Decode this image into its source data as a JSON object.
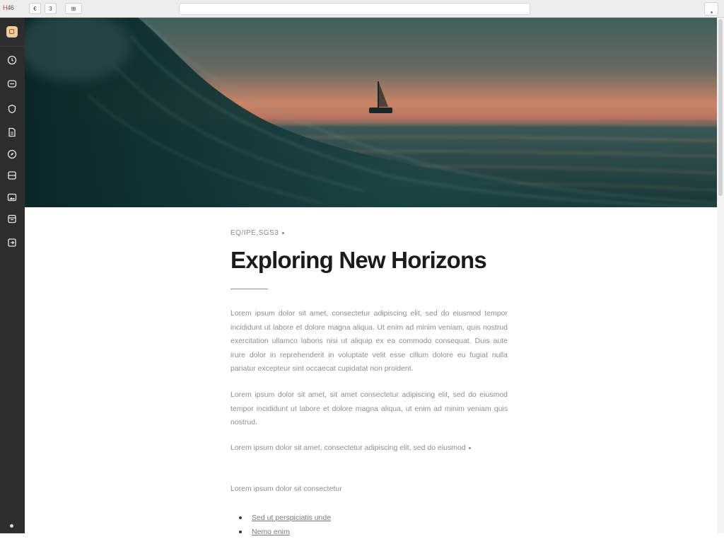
{
  "browser": {
    "brand_mark": "H",
    "brand_rest": "46",
    "back_glyph": "€",
    "forward_glyph": "3",
    "tabs_glyph": "⊞",
    "url": "",
    "menu_icon": "menu-icon"
  },
  "sidebar": {
    "logo_icon": "app-logo-icon",
    "items": [
      {
        "icon": "clock-icon"
      },
      {
        "icon": "message-icon"
      },
      {
        "icon": "shield-icon"
      },
      {
        "icon": "document-icon"
      },
      {
        "icon": "compass-icon"
      },
      {
        "icon": "grid-icon"
      },
      {
        "icon": "image-icon"
      },
      {
        "icon": "calendar-icon"
      },
      {
        "icon": "export-icon"
      }
    ]
  },
  "hero": {
    "image_icon": "ocean-wave-sunset-image",
    "colors": {
      "sky_top": "#40605e",
      "horizon": "#d98866",
      "sea": "#1f4e4e",
      "wave": "#0d2b2c"
    }
  },
  "article": {
    "kicker": "EQ/IPE,SGS3",
    "title": "Exploring New Horizons",
    "paragraphs": [
      "Lorem ipsum dolor sit amet, consectetur adipiscing elit, sed do eiusmod tempor incididunt ut labore et dolore magna aliqua. Ut enim ad minim veniam, quis nostrud exercitation ullamco laboris nisi ut aliquip ex ea commodo consequat. Duis aute irure dolor in reprehenderit in voluptate velit esse cillum dolore eu fugiat nulla pariatur excepteur sint occaecat cupidatat non proident.",
      "Lorem ipsum dolor sit amet, sit amet consectetur adipiscing elit, sed do eiusmod tempor incididunt ut labore et dolore magna aliqua, ut enim ad minim veniam quis nostrud.",
      "Lorem ipsum dolor sit amet, consectetur adipiscing elit, sed do eiusmod",
      "Lorem ipsum dolor sit consectetur"
    ],
    "list": [
      "Sed ut perspiciatis unde",
      "Nemo enim"
    ]
  }
}
